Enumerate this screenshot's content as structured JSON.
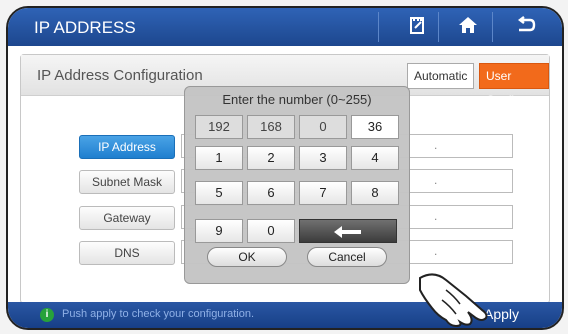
{
  "header": {
    "title": "IP ADDRESS",
    "icons": [
      "note-edit-icon",
      "home-icon",
      "back-icon"
    ]
  },
  "panel": {
    "title": "IP Address Configuration",
    "mode_automatic": "Automatic",
    "mode_user": "User Config",
    "rows": [
      {
        "label": "IP Address",
        "active": true
      },
      {
        "label": "Subnet Mask",
        "active": false
      },
      {
        "label": "Gateway",
        "active": false
      },
      {
        "label": "DNS",
        "active": false
      }
    ],
    "field_separators": "."
  },
  "keypad": {
    "title": "Enter the number (0~255)",
    "octets": [
      "192",
      "168",
      "0",
      "36"
    ],
    "keys": [
      "1",
      "2",
      "3",
      "4",
      "5",
      "6",
      "7",
      "8",
      "9",
      "0"
    ],
    "ok_label": "OK",
    "cancel_label": "Cancel",
    "backspace_icon": "left-arrow-icon"
  },
  "footer": {
    "hint": "Push apply to check your configuration.",
    "apply_label": "Apply"
  },
  "colors": {
    "title_bar": "#1d478e",
    "accent_orange": "#f26a1b",
    "active_blue": "#1f7fcf",
    "info_green": "#27a23a"
  }
}
